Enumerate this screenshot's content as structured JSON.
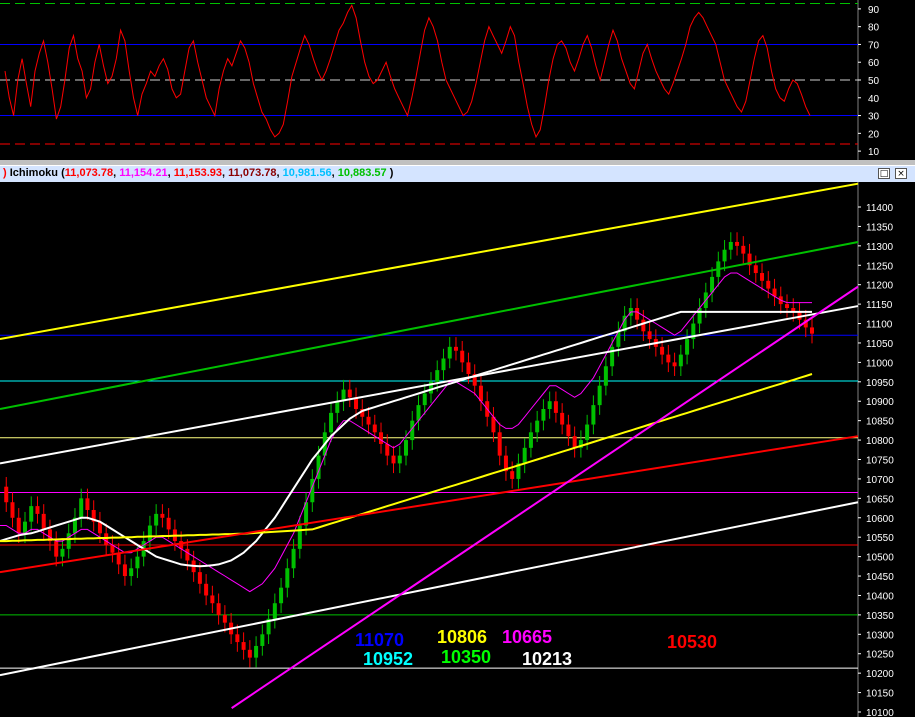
{
  "title_bar": {
    "name": "Ichimoku",
    "values": [
      {
        "text": "11,073.78",
        "color": "#ff0000"
      },
      {
        "text": "11,154.21",
        "color": "#ff00ff"
      },
      {
        "text": "11,153.93",
        "color": "#ff0000"
      },
      {
        "text": "11,073.78",
        "color": "#8b0000"
      },
      {
        "text": "10,981.56",
        "color": "#00c0ff"
      },
      {
        "text": "10,883.57",
        "color": "#00c000"
      }
    ],
    "buttons": [
      "restore-icon",
      "close-icon"
    ]
  },
  "chart_data": [
    {
      "type": "line",
      "panel": "oscillator",
      "ylim": [
        5,
        95
      ],
      "yticks": [
        "90",
        "80",
        "70",
        "60",
        "50",
        "40",
        "30",
        "20",
        "10"
      ],
      "levels": [
        {
          "value": 93,
          "color": "#00c000",
          "style": "dashed"
        },
        {
          "value": 70,
          "color": "#0000ff",
          "style": "solid"
        },
        {
          "value": 50,
          "color": "#d0d0d0",
          "style": "dashed"
        },
        {
          "value": 30,
          "color": "#0000ff",
          "style": "solid"
        },
        {
          "value": 14,
          "color": "#ff0000",
          "style": "dashed"
        }
      ],
      "series": [
        {
          "color": "#ff0000",
          "values": [
            55,
            40,
            30,
            50,
            62,
            48,
            35,
            55,
            65,
            72,
            60,
            45,
            28,
            35,
            50,
            68,
            75,
            62,
            55,
            40,
            45,
            60,
            70,
            58,
            48,
            52,
            62,
            78,
            72,
            55,
            40,
            30,
            42,
            48,
            55,
            52,
            58,
            62,
            56,
            45,
            40,
            42,
            55,
            68,
            72,
            60,
            50,
            40,
            35,
            30,
            45,
            55,
            62,
            58,
            65,
            72,
            68,
            60,
            48,
            40,
            32,
            28,
            22,
            18,
            20,
            25,
            38,
            52,
            60,
            68,
            75,
            70,
            62,
            55,
            50,
            55,
            62,
            70,
            78,
            82,
            88,
            92,
            85,
            72,
            60,
            52,
            48,
            50,
            55,
            60,
            52,
            45,
            40,
            35,
            30,
            40,
            52,
            65,
            78,
            85,
            80,
            72,
            60,
            50,
            45,
            40,
            35,
            30,
            32,
            38,
            48,
            60,
            72,
            80,
            75,
            70,
            65,
            72,
            80,
            75,
            60,
            48,
            35,
            25,
            18,
            22,
            35,
            50,
            62,
            70,
            72,
            68,
            60,
            55,
            62,
            70,
            75,
            68,
            58,
            50,
            60,
            70,
            78,
            72,
            62,
            55,
            48,
            45,
            55,
            65,
            70,
            62,
            55,
            50,
            45,
            42,
            48,
            55,
            62,
            70,
            80,
            85,
            88,
            85,
            80,
            75,
            70,
            60,
            50,
            45,
            40,
            35,
            32,
            38,
            50,
            62,
            72,
            75,
            68,
            55,
            45,
            40,
            38,
            45,
            50,
            48,
            42,
            35,
            30
          ]
        }
      ]
    },
    {
      "type": "line",
      "panel": "price",
      "ylim": [
        10100,
        11500
      ],
      "yticks": [
        "11400",
        "11350",
        "11300",
        "11250",
        "11200",
        "11150",
        "11100",
        "11050",
        "11000",
        "10950",
        "10900",
        "10850",
        "10800",
        "10750",
        "10700",
        "10650",
        "10600",
        "10550",
        "10500",
        "10450",
        "10400",
        "10350",
        "10300",
        "10250",
        "10200",
        "10150",
        "10100"
      ],
      "horizontal_levels": [
        {
          "value": 11070,
          "color": "#0000ff"
        },
        {
          "value": 10952,
          "color": "#00ffff"
        },
        {
          "value": 10806,
          "color": "#ffff80"
        },
        {
          "value": 10665,
          "color": "#ff00ff"
        },
        {
          "value": 10530,
          "color": "#ff0000"
        },
        {
          "value": 10350,
          "color": "#00c000"
        },
        {
          "value": 10213,
          "color": "#ffffff"
        }
      ],
      "trend_lines": [
        {
          "color": "#ffff00",
          "from": [
            0,
            11060
          ],
          "to": [
            1,
            11460
          ]
        },
        {
          "color": "#00c000",
          "from": [
            0,
            10880
          ],
          "to": [
            1,
            11310
          ]
        },
        {
          "color": "#ffffff",
          "from": [
            0,
            10740
          ],
          "to": [
            1,
            11145
          ]
        },
        {
          "color": "#ffffff",
          "from": [
            0,
            10195
          ],
          "to": [
            1,
            10640
          ]
        },
        {
          "color": "#ff0000",
          "from": [
            0,
            10460
          ],
          "to": [
            1,
            10810
          ]
        },
        {
          "color": "#ff00ff",
          "from": [
            0.27,
            10110
          ],
          "to": [
            1,
            11195
          ]
        }
      ],
      "annotations": [
        {
          "text": "11070",
          "color": "#0000ff"
        },
        {
          "text": "10952",
          "color": "#00ffff"
        },
        {
          "text": "10806",
          "color": "#ffff00"
        },
        {
          "text": "10350",
          "color": "#00ff00"
        },
        {
          "text": "10665",
          "color": "#ff00ff"
        },
        {
          "text": "10213",
          "color": "#ffffff"
        },
        {
          "text": "10530",
          "color": "#ff0000"
        }
      ],
      "series": [
        {
          "name": "close",
          "values": [
            10680,
            10640,
            10600,
            10560,
            10590,
            10630,
            10610,
            10570,
            10540,
            10500,
            10520,
            10560,
            10600,
            10650,
            10620,
            10590,
            10560,
            10530,
            10510,
            10480,
            10450,
            10470,
            10500,
            10540,
            10580,
            10610,
            10600,
            10570,
            10540,
            10520,
            10490,
            10460,
            10430,
            10400,
            10380,
            10350,
            10330,
            10300,
            10280,
            10260,
            10240,
            10270,
            10300,
            10340,
            10380,
            10420,
            10470,
            10520,
            10580,
            10640,
            10700,
            10760,
            10820,
            10870,
            10900,
            10930,
            10910,
            10880,
            10860,
            10840,
            10820,
            10790,
            10760,
            10740,
            10760,
            10800,
            10850,
            10890,
            10920,
            10950,
            10980,
            11010,
            11040,
            11030,
            11000,
            10970,
            10940,
            10900,
            10860,
            10820,
            10760,
            10720,
            10700,
            10740,
            10780,
            10820,
            10850,
            10880,
            10900,
            10870,
            10840,
            10810,
            10780,
            10800,
            10840,
            10890,
            10940,
            10990,
            11040,
            11080,
            11120,
            11140,
            11110,
            11080,
            11060,
            11040,
            11020,
            11000,
            10990,
            11020,
            11060,
            11100,
            11140,
            11180,
            11220,
            11260,
            11290,
            11310,
            11300,
            11280,
            11250,
            11230,
            11210,
            11190,
            11170,
            11150,
            11140,
            11130,
            11110,
            11090,
            11074
          ]
        },
        {
          "name": "kijun",
          "color": "#ff00ff",
          "values": [
            10580,
            10580,
            10570,
            10560,
            10560,
            10570,
            10570,
            10560,
            10550,
            10540,
            10540,
            10550,
            10560,
            10570,
            10570,
            10560,
            10550,
            10540,
            10530,
            10520,
            10510,
            10510,
            10520,
            10530,
            10540,
            10550,
            10550,
            10540,
            10530,
            10520,
            10510,
            10500,
            10490,
            10480,
            10470,
            10460,
            10450,
            10440,
            10430,
            10420,
            10410,
            10420,
            10430,
            10450,
            10470,
            10500,
            10530,
            10560,
            10600,
            10640,
            10680,
            10720,
            10760,
            10800,
            10830,
            10850,
            10850,
            10840,
            10830,
            10820,
            10810,
            10800,
            10790,
            10780,
            10790,
            10810,
            10830,
            10850,
            10870,
            10890,
            10910,
            10930,
            10950,
            10950,
            10940,
            10930,
            10920,
            10900,
            10880,
            10860,
            10840,
            10830,
            10830,
            10840,
            10860,
            10880,
            10900,
            10920,
            10940,
            10940,
            10930,
            10920,
            10910,
            10920,
            10940,
            10960,
            10990,
            11020,
            11050,
            11080,
            11110,
            11130,
            11130,
            11120,
            11110,
            11100,
            11090,
            11080,
            11070,
            11080,
            11100,
            11120,
            11140,
            11160,
            11180,
            11200,
            11220,
            11230,
            11230,
            11220,
            11210,
            11200,
            11190,
            11180,
            11170,
            11160,
            11154,
            11154,
            11154,
            11154,
            11154
          ]
        },
        {
          "name": "ma",
          "color": "#ffffff",
          "values": [
            10540,
            10545,
            10550,
            10555,
            10558,
            10560,
            10565,
            10570,
            10575,
            10580,
            10585,
            10590,
            10595,
            10600,
            10600,
            10595,
            10590,
            10580,
            10570,
            10560,
            10550,
            10540,
            10530,
            10520,
            10510,
            10500,
            10495,
            10490,
            10485,
            10480,
            10478,
            10476,
            10475,
            10476,
            10478,
            10480,
            10485,
            10490,
            10500,
            10510,
            10525,
            10540,
            10560,
            10580,
            10600,
            10625,
            10650,
            10675,
            10700,
            10725,
            10750,
            10770,
            10790,
            10810,
            10825,
            10840,
            10855,
            10865,
            10875,
            10880,
            10885,
            10890,
            10895,
            10900,
            10905,
            10910,
            10915,
            10920,
            10925,
            10930,
            10935,
            10940,
            10945,
            10950,
            10955,
            10960,
            10965,
            10970,
            10975,
            10980,
            10985,
            10990,
            10995,
            11000,
            11005,
            11010,
            11015,
            11020,
            11025,
            11030,
            11035,
            11040,
            11045,
            11050,
            11055,
            11060,
            11065,
            11070,
            11075,
            11080,
            11085,
            11090,
            11095,
            11100,
            11105,
            11110,
            11115,
            11120,
            11125,
            11130,
            11130,
            11130,
            11130,
            11130,
            11130,
            11130,
            11130,
            11130,
            11130,
            11130,
            11130,
            11130,
            11130,
            11130,
            11130,
            11130,
            11130,
            11130,
            11130,
            11130,
            11130
          ]
        },
        {
          "name": "ma-long",
          "color": "#ffff00",
          "values": [
            10540,
            10540,
            10541,
            10541,
            10542,
            10542,
            10543,
            10543,
            10544,
            10544,
            10545,
            10545,
            10546,
            10546,
            10547,
            10547,
            10548,
            10548,
            10549,
            10549,
            10550,
            10550,
            10551,
            10551,
            10552,
            10552,
            10553,
            10553,
            10554,
            10554,
            10555,
            10555,
            10556,
            10556,
            10557,
            10557,
            10558,
            10558,
            10559,
            10559,
            10560,
            10561,
            10562,
            10563,
            10564,
            10565,
            10566,
            10567,
            10568,
            10569,
            10570,
            10575,
            10580,
            10585,
            10590,
            10595,
            10600,
            10605,
            10610,
            10615,
            10620,
            10625,
            10630,
            10635,
            10640,
            10645,
            10650,
            10655,
            10660,
            10665,
            10670,
            10675,
            10680,
            10685,
            10690,
            10695,
            10700,
            10705,
            10710,
            10715,
            10720,
            10725,
            10730,
            10735,
            10740,
            10745,
            10750,
            10755,
            10760,
            10765,
            10770,
            10775,
            10780,
            10785,
            10790,
            10795,
            10800,
            10805,
            10810,
            10815,
            10820,
            10825,
            10830,
            10835,
            10840,
            10845,
            10850,
            10855,
            10860,
            10865,
            10870,
            10875,
            10880,
            10885,
            10890,
            10895,
            10900,
            10905,
            10910,
            10915,
            10920,
            10925,
            10930,
            10935,
            10940,
            10945,
            10950,
            10955,
            10960,
            10965,
            10970
          ]
        }
      ]
    }
  ]
}
